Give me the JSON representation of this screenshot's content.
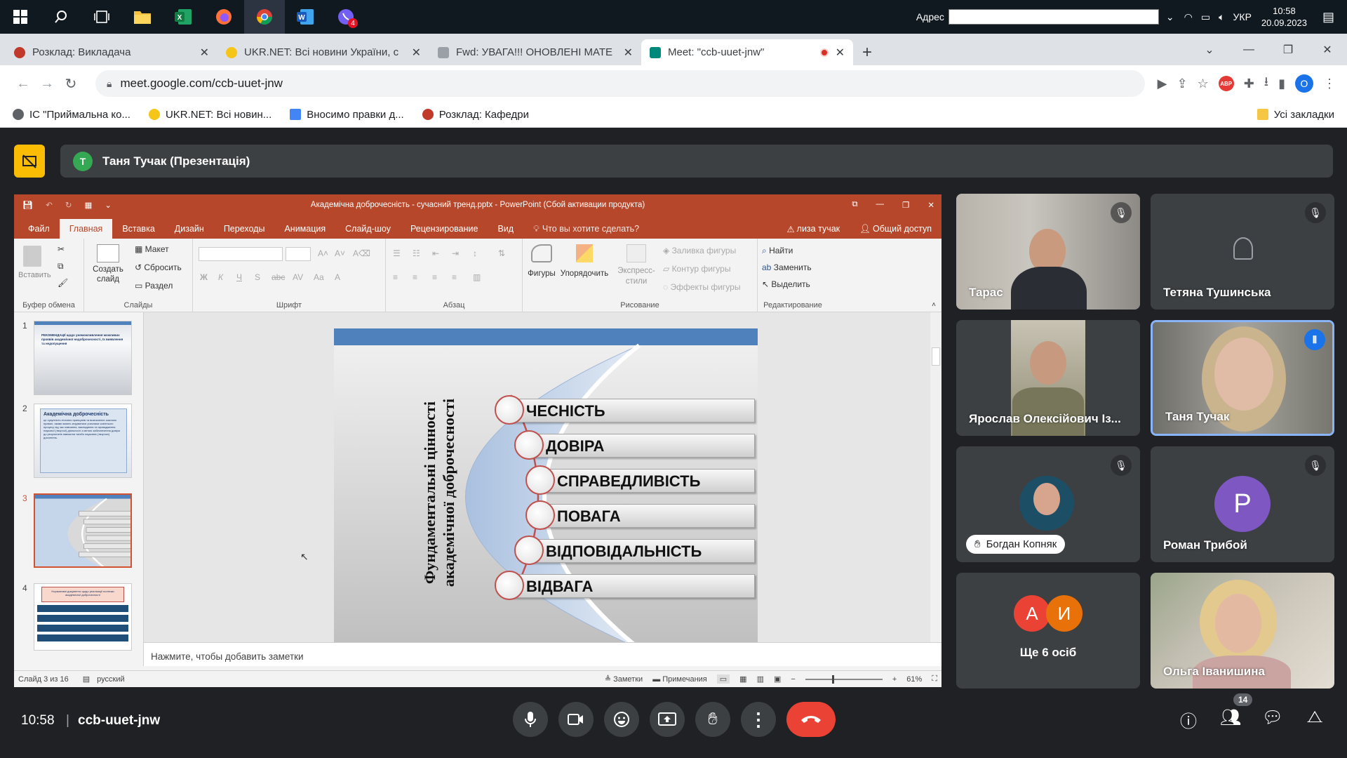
{
  "taskbar": {
    "apps": [
      {
        "icon": "windows-start-icon"
      },
      {
        "icon": "search-icon"
      },
      {
        "icon": "task-view-icon"
      },
      {
        "icon": "file-explorer-icon"
      },
      {
        "icon": "excel-icon"
      },
      {
        "icon": "firefox-icon"
      },
      {
        "icon": "chrome-icon"
      },
      {
        "icon": "word-icon"
      },
      {
        "icon": "viber-icon",
        "badge": "4"
      }
    ],
    "address_label": "Адрес",
    "language": "УКР",
    "time": "10:58",
    "date": "20.09.2023"
  },
  "browser": {
    "tabs": [
      {
        "title": "Розклад: Викладача",
        "color": "#c0392b",
        "active": false
      },
      {
        "title": "UKR.NET: Всі новини України, с",
        "color": "#f5c518",
        "active": false
      },
      {
        "title": "Fwd: УВАГА!!! ОНОВЛЕНІ МАТЕ",
        "color": "#9aa0a6",
        "active": false
      },
      {
        "title": "Meet: \"ccb-uuet-jnw\"",
        "color": "#00897b",
        "active": true
      }
    ],
    "url": "meet.google.com/ccb-uuet-jnw",
    "profile_initial": "O",
    "bookmarks": [
      {
        "label": "ІС \"Приймальна ко...",
        "color": "#5f6368"
      },
      {
        "label": "UKR.NET: Всі новин...",
        "color": "#f5c518"
      },
      {
        "label": "Вносимо правки д...",
        "color": "#4285f4"
      },
      {
        "label": "Розклад: Кафедри",
        "color": "#c0392b"
      }
    ],
    "all_bookmarks": "Усі закладки"
  },
  "meet": {
    "presenter_initial": "Т",
    "presenter_banner": "Таня Тучак (Презентація)",
    "time": "10:58",
    "meeting_code": "ccb-uuet-jnw",
    "participant_count": "14",
    "participants": [
      {
        "name": "Тарас",
        "muted": true
      },
      {
        "name": "Тетяна Тушинська",
        "muted": true
      },
      {
        "name": "Ярослав Олексійович Із...",
        "muted": false
      },
      {
        "name": "Таня Тучак",
        "muted": false,
        "speaking": true
      },
      {
        "name": "Богдан Копняк",
        "muted": true
      },
      {
        "name": "Роман Трибой",
        "initial": "Р",
        "muted": true
      },
      {
        "name": "Ще 6 осіб",
        "initials": [
          "А",
          "И"
        ]
      },
      {
        "name": "Ольга Іванишина",
        "muted": false
      }
    ]
  },
  "powerpoint": {
    "window_title": "Академічна доброчесність - сучасний тренд.pptx - PowerPoint (Сбой активации продукта)",
    "tabs": [
      "Файл",
      "Главная",
      "Вставка",
      "Дизайн",
      "Переходы",
      "Анимация",
      "Слайд-шоу",
      "Рецензирование",
      "Вид"
    ],
    "active_tab": "Главная",
    "tell_me": "Что вы хотите сделать?",
    "user": "лиза тучак",
    "share": "Общий доступ",
    "ribbon": {
      "paste": "Вставить",
      "new_slide": "Создать слайд",
      "layout": "Макет",
      "reset": "Сбросить",
      "section": "Раздел",
      "shapes": "Фигуры",
      "arrange": "Упорядочить",
      "quick_styles": "Экспресс-стили",
      "shape_fill": "Заливка фигуры",
      "shape_outline": "Контур фигуры",
      "shape_effects": "Эффекты фигуры",
      "find": "Найти",
      "replace": "Заменить",
      "select": "Выделить",
      "groups": [
        "Буфер обмена",
        "Слайды",
        "Шрифт",
        "Абзац",
        "Рисование",
        "Редактирование"
      ]
    },
    "thumbnails": [
      "1",
      "2",
      "3",
      "4"
    ],
    "selected_thumbnail": 3,
    "thumb1_text": "РЕКОМЕНДАЦІЇ щодо унеможливлення можливих проявів академічної недоброчесності, їх виявлення та недопущення",
    "thumb2_title": "Академічна доброчесність",
    "thumb2_body": "це сукупність етичних принципів та визначених законом правил, якими мають керуватися учасники освітнього процесу під час навчання, викладання та провадження наукової (творчої) діяльності з метою забезпечення довіри до результатів навчання та/або наукових (творчих) досягнень.",
    "thumb4_header": "Нормативні документи щодо реалізації політики академічної доброчесності",
    "slide": {
      "vertical_title": "Фундаментальні цінності академічної доброчесності",
      "values": [
        "ЧЕСНІСТЬ",
        "ДОВІРА",
        "СПРАВЕДЛИВІСТЬ",
        "ПОВАГА",
        "ВІДПОВІДАЛЬНІСТЬ",
        "ВІДВАГА"
      ]
    },
    "notes_placeholder": "Нажмите, чтобы добавить заметки",
    "status": {
      "slide_of": "Слайд 3 из 16",
      "language": "русский",
      "notes": "Заметки",
      "comments": "Примечания",
      "zoom": "61%"
    }
  }
}
